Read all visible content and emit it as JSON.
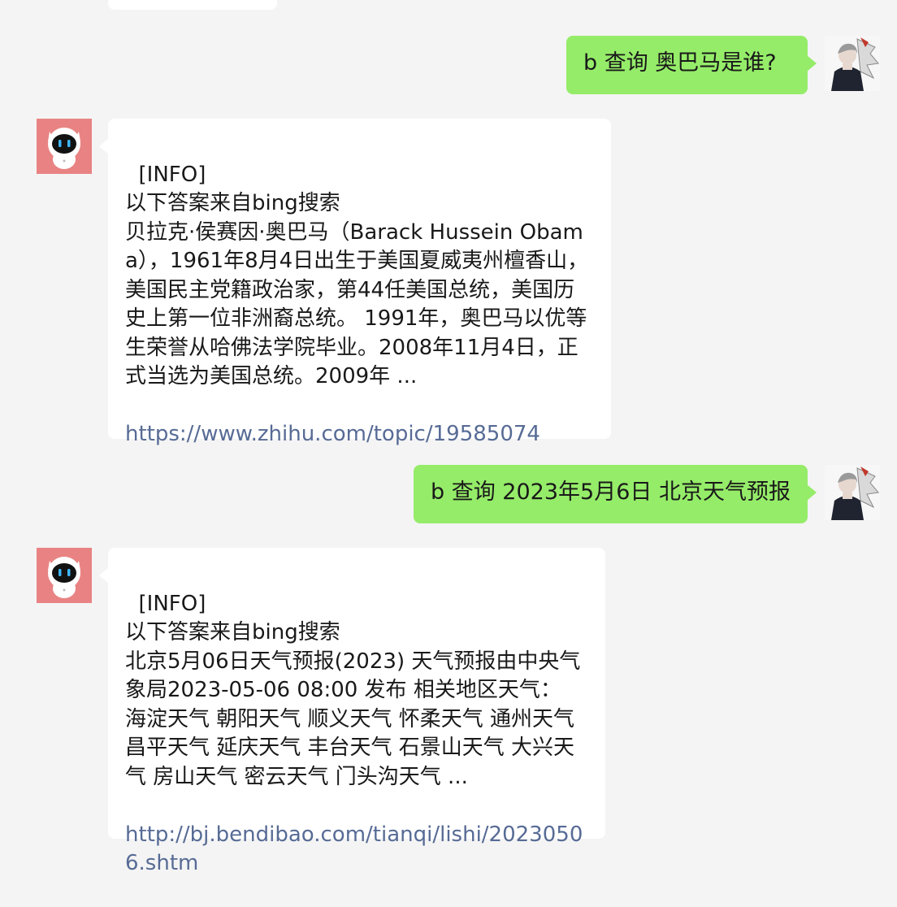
{
  "messages": [
    {
      "sender": "user",
      "text": "b 查询 奥巴马是谁?"
    },
    {
      "sender": "bot",
      "text": "[INFO]\n以下答案来自bing搜索\n贝拉克·侯赛因·奥巴马（Barack Hussein Obama），1961年8月4日出生于美国夏威夷州檀香山，美国民主党籍政治家，第44任美国总统，美国历史上第一位非洲裔总统。 1991年，奥巴马以优等生荣誉从哈佛法学院毕业。2008年11月4日，正式当选为美国总统。2009年 ...",
      "link": "https://www.zhihu.com/topic/19585074"
    },
    {
      "sender": "user",
      "text": "b 查询 2023年5月6日 北京天气预报"
    },
    {
      "sender": "bot",
      "text": "[INFO]\n以下答案来自bing搜索\n北京5月06日天气预报(2023) 天气预报由中央气象局2023-05-06 08:00 发布 相关地区天气： 海淀天气 朝阳天气 顺义天气 怀柔天气 通州天气 昌平天气 延庆天气 丰台天气 石景山天气 大兴天气 房山天气 密云天气 门头沟天气 ...",
      "link": "http://bj.bendibao.com/tianqi/lishi/20230506.shtm"
    }
  ],
  "colors": {
    "background": "#f4f4f4",
    "bot_bubble": "#ffffff",
    "user_bubble": "#95ec69",
    "link": "#576b95",
    "bot_avatar": "#e98383"
  }
}
